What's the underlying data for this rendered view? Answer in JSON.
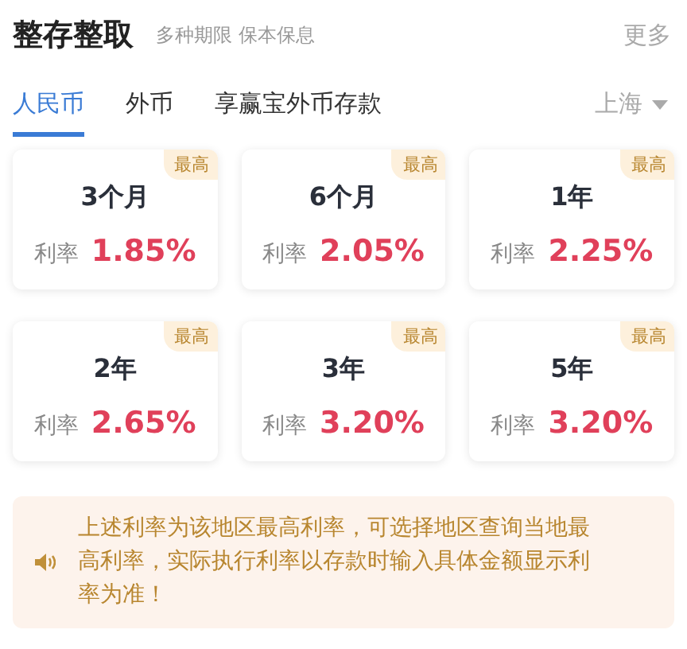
{
  "header": {
    "title": "整存整取",
    "subtitle": "多种期限 保本保息",
    "more": "更多"
  },
  "tabs": [
    {
      "label": "人民币",
      "selected": true
    },
    {
      "label": "外币",
      "selected": false
    },
    {
      "label": "享赢宝外币存款",
      "selected": false
    }
  ],
  "region": {
    "label": "上海"
  },
  "products": [
    {
      "term": "3个月",
      "badge": "最高",
      "rate_label": "利率",
      "rate": "1.85%"
    },
    {
      "term": "6个月",
      "badge": "最高",
      "rate_label": "利率",
      "rate": "2.05%"
    },
    {
      "term": "1年",
      "badge": "最高",
      "rate_label": "利率",
      "rate": "2.25%"
    },
    {
      "term": "2年",
      "badge": "最高",
      "rate_label": "利率",
      "rate": "2.65%"
    },
    {
      "term": "3年",
      "badge": "最高",
      "rate_label": "利率",
      "rate": "3.20%"
    },
    {
      "term": "5年",
      "badge": "最高",
      "rate_label": "利率",
      "rate": "3.20%"
    }
  ],
  "notice": {
    "text": "上述利率为该地区最高利率，可选择地区查询当地最高利率，实际执行利率以存款时输入具体金额显示利率为准！"
  }
}
